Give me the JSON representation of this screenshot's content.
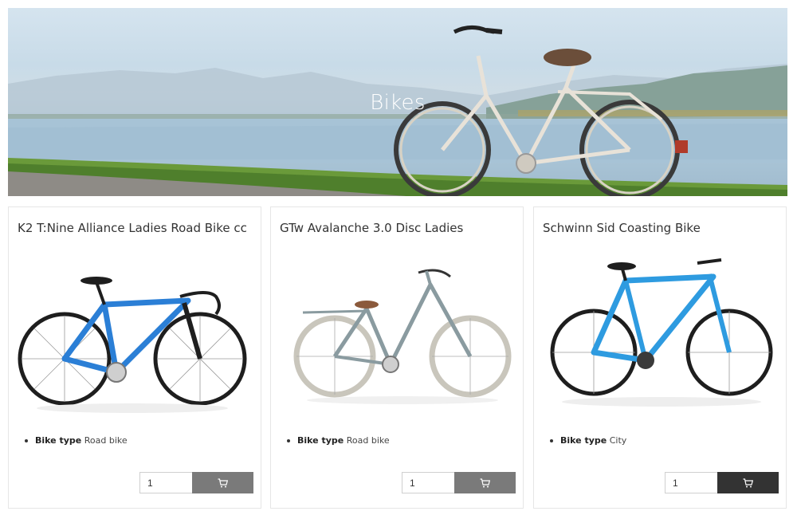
{
  "hero": {
    "title": "Bikes"
  },
  "products": [
    {
      "title": "K2 T:Nine Alliance Ladies Road Bike cc",
      "spec_label": "Bike type",
      "spec_value": "Road bike",
      "quantity": "1",
      "bike_color": "#2b7fd6",
      "cart_button_color": "#7a7a7a"
    },
    {
      "title": "GTw Avalanche 3.0 Disc Ladies",
      "spec_label": "Bike type",
      "spec_value": "Road bike",
      "quantity": "1",
      "bike_color": "#8a9ba0",
      "cart_button_color": "#7a7a7a"
    },
    {
      "title": "Schwinn Sid Coasting Bike",
      "spec_label": "Bike type",
      "spec_value": "City",
      "quantity": "1",
      "bike_color": "#2e9be0",
      "cart_button_color": "#333333"
    }
  ],
  "icons": {
    "cart": "cart-icon"
  }
}
